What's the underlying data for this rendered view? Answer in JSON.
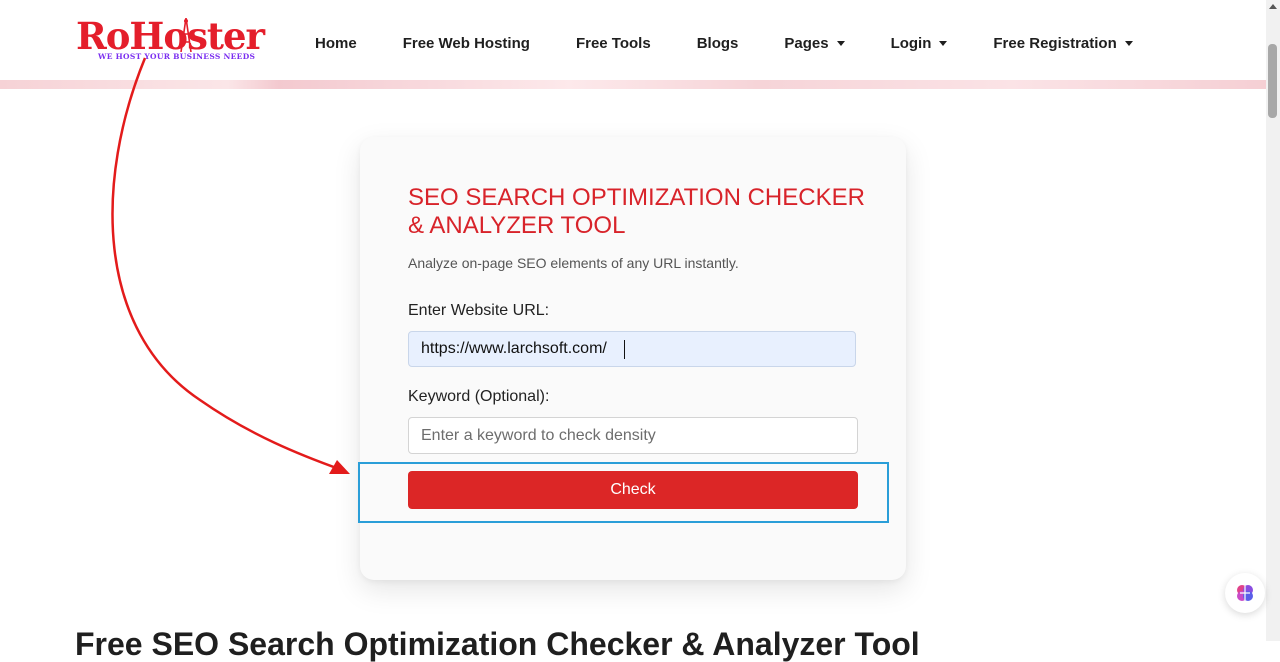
{
  "logo": {
    "name": "RoHoster",
    "tagline": "WE HOST YOUR BUSINESS NEEDS"
  },
  "nav": {
    "items": [
      {
        "label": "Home",
        "dropdown": false
      },
      {
        "label": "Free Web Hosting",
        "dropdown": false
      },
      {
        "label": "Free Tools",
        "dropdown": false
      },
      {
        "label": "Blogs",
        "dropdown": false
      },
      {
        "label": "Pages",
        "dropdown": true
      },
      {
        "label": "Login",
        "dropdown": true
      },
      {
        "label": "Free Registration",
        "dropdown": true
      }
    ]
  },
  "tool": {
    "title": "SEO SEARCH OPTIMIZATION CHECKER & ANALYZER TOOL",
    "subtitle": "Analyze on-page SEO elements of any URL instantly.",
    "url_label": "Enter Website URL:",
    "url_value": "https://www.larchsoft.com/",
    "keyword_label": "Keyword (Optional):",
    "keyword_placeholder": "Enter a keyword to check density",
    "check_label": "Check"
  },
  "section": {
    "heading": "Free SEO Search Optimization Checker & Analyzer Tool"
  },
  "colors": {
    "brand_red": "#e41e2b",
    "button_red": "#dc2626",
    "title_red": "#d8232a",
    "highlight_blue": "#2a9ed8",
    "tagline_purple": "#7b2ff0"
  },
  "icons": {
    "ai_widget": "brain-icon",
    "nav_dropdown": "caret-down-icon"
  }
}
